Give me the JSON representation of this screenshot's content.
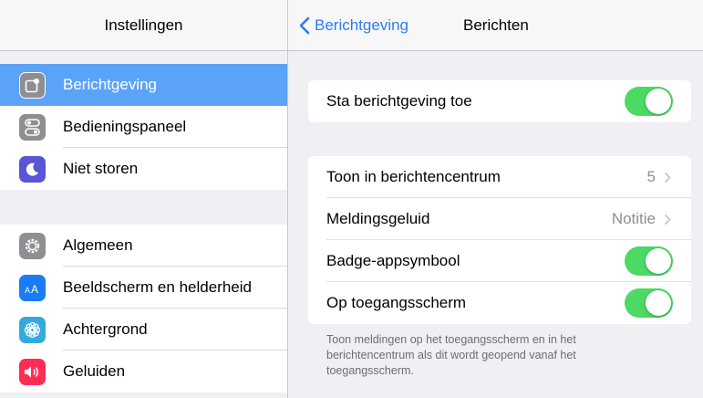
{
  "sidebar": {
    "title": "Instellingen",
    "groups": [
      {
        "items": [
          {
            "label": "Berichtgeving",
            "icon": "notifications-icon",
            "color": "#8e8e93",
            "selected": true
          },
          {
            "label": "Bedieningspaneel",
            "icon": "control-center-icon",
            "color": "#8e8e93"
          },
          {
            "label": "Niet storen",
            "icon": "moon-icon",
            "color": "#5856d6"
          }
        ]
      },
      {
        "items": [
          {
            "label": "Algemeen",
            "icon": "gear-icon",
            "color": "#8e8e93"
          },
          {
            "label": "Beeldscherm en helderheid",
            "icon": "display-brightness-icon",
            "color": "#1a7cf5"
          },
          {
            "label": "Achtergrond",
            "icon": "wallpaper-icon",
            "color": "#34aadc"
          },
          {
            "label": "Geluiden",
            "icon": "speaker-icon",
            "color": "#ff2d55"
          }
        ]
      }
    ]
  },
  "detail": {
    "back_label": "Berichtgeving",
    "title": "Berichten",
    "allow": {
      "label": "Sta berichtgeving toe",
      "on": true
    },
    "rows": [
      {
        "label": "Toon in berichtencentrum",
        "value": "5"
      },
      {
        "label": "Meldingsgeluid",
        "value": "Notitie"
      },
      {
        "label": "Badge-appsymbool",
        "on": true
      },
      {
        "label": "Op toegangsscherm",
        "on": true
      }
    ],
    "footnote": "Toon meldingen op het toegangsscherm en in het berichtencentrum als dit wordt geopend vanaf het toegangsscherm."
  },
  "colors": {
    "accent": "#2f7bf5",
    "selected": "#5ba3f8",
    "toggle_on": "#4cd964"
  }
}
